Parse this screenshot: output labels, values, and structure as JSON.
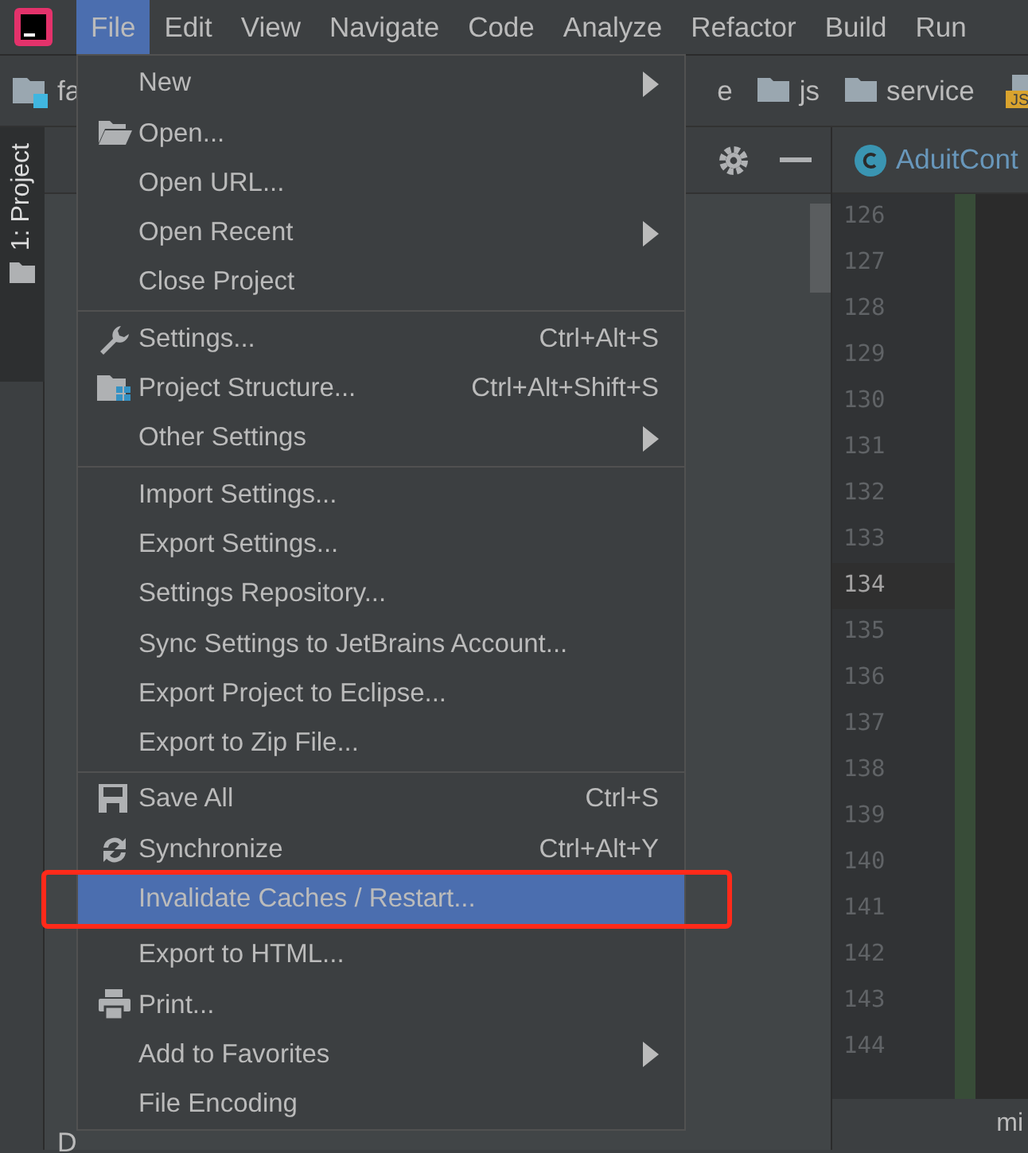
{
  "menubar": [
    {
      "label": "File",
      "selected": true
    },
    {
      "label": "Edit",
      "selected": false
    },
    {
      "label": "View",
      "selected": false
    },
    {
      "label": "Navigate",
      "selected": false
    },
    {
      "label": "Code",
      "selected": false
    },
    {
      "label": "Analyze",
      "selected": false
    },
    {
      "label": "Refactor",
      "selected": false
    },
    {
      "label": "Build",
      "selected": false
    },
    {
      "label": "Run",
      "selected": false
    }
  ],
  "breadcrumbs": [
    {
      "label": "fa",
      "kind": "project"
    },
    {
      "label": "e",
      "kind": "partial"
    },
    {
      "label": "js",
      "kind": "folder"
    },
    {
      "label": "service",
      "kind": "folder"
    },
    {
      "label": "JS",
      "kind": "jsfile"
    }
  ],
  "tool_strip": {
    "tab": "1: Project"
  },
  "editor": {
    "tab": "AduitCont",
    "lines": [
      {
        "number": "126",
        "current": false
      },
      {
        "number": "127",
        "current": false
      },
      {
        "number": "128",
        "current": false
      },
      {
        "number": "129",
        "current": false
      },
      {
        "number": "130",
        "current": false
      },
      {
        "number": "131",
        "current": false
      },
      {
        "number": "132",
        "current": false
      },
      {
        "number": "133",
        "current": false
      },
      {
        "number": "134",
        "current": true
      },
      {
        "number": "135",
        "current": false
      },
      {
        "number": "136",
        "current": false
      },
      {
        "number": "137",
        "current": false
      },
      {
        "number": "138",
        "current": false
      },
      {
        "number": "139",
        "current": false
      },
      {
        "number": "140",
        "current": false
      },
      {
        "number": "141",
        "current": false
      },
      {
        "number": "142",
        "current": false
      },
      {
        "number": "143",
        "current": false
      },
      {
        "number": "144",
        "current": false
      }
    ],
    "status_text": "mi"
  },
  "bottom_tab": "D",
  "file_menu": [
    {
      "kind": "item",
      "label": "New",
      "submenu": true,
      "selected": false,
      "disabled": false
    },
    {
      "kind": "item",
      "label": "Open...",
      "selected": false,
      "disabled": false
    },
    {
      "kind": "item",
      "label": "Open URL...",
      "selected": false,
      "disabled": false
    },
    {
      "kind": "item",
      "label": "Open Recent",
      "submenu": true,
      "selected": false,
      "disabled": false
    },
    {
      "kind": "item",
      "label": "Close Project",
      "selected": false,
      "disabled": false
    },
    {
      "kind": "separator"
    },
    {
      "kind": "item",
      "label": "Settings...",
      "shortcut": "Ctrl+Alt+S",
      "selected": false,
      "disabled": false
    },
    {
      "kind": "item",
      "label": "Project Structure...",
      "shortcut": "Ctrl+Alt+Shift+S",
      "selected": false,
      "disabled": false
    },
    {
      "kind": "item",
      "label": "Other Settings",
      "submenu": true,
      "selected": false,
      "disabled": false
    },
    {
      "kind": "separator"
    },
    {
      "kind": "item",
      "label": "Import Settings...",
      "selected": false,
      "disabled": false
    },
    {
      "kind": "item",
      "label": "Export Settings...",
      "selected": false,
      "disabled": false
    },
    {
      "kind": "item",
      "label": "Settings Repository...",
      "selected": false,
      "disabled": false
    },
    {
      "kind": "item",
      "label": "Sync Settings to JetBrains Account...",
      "selected": false,
      "disabled": false
    },
    {
      "kind": "item",
      "label": "Export Project to Eclipse...",
      "selected": false,
      "disabled": false
    },
    {
      "kind": "item",
      "label": "Export to Zip File...",
      "selected": false,
      "disabled": false
    },
    {
      "kind": "separator"
    },
    {
      "kind": "item",
      "label": "Save All",
      "shortcut": "Ctrl+S",
      "selected": false,
      "disabled": false
    },
    {
      "kind": "item",
      "label": "Synchronize",
      "shortcut": "Ctrl+Alt+Y",
      "selected": false,
      "disabled": false
    },
    {
      "kind": "item",
      "label": "Invalidate Caches / Restart...",
      "selected": true,
      "disabled": false,
      "outlined": true
    },
    {
      "kind": "separator"
    },
    {
      "kind": "item",
      "label": "Export to HTML...",
      "selected": false,
      "disabled": false
    },
    {
      "kind": "item",
      "label": "Print...",
      "selected": false,
      "disabled": false
    },
    {
      "kind": "item",
      "label": "Add to Favorites",
      "submenu": true,
      "selected": false,
      "disabled": false
    },
    {
      "kind": "item",
      "label": "File Encoding",
      "selected": false,
      "disabled": false
    }
  ]
}
